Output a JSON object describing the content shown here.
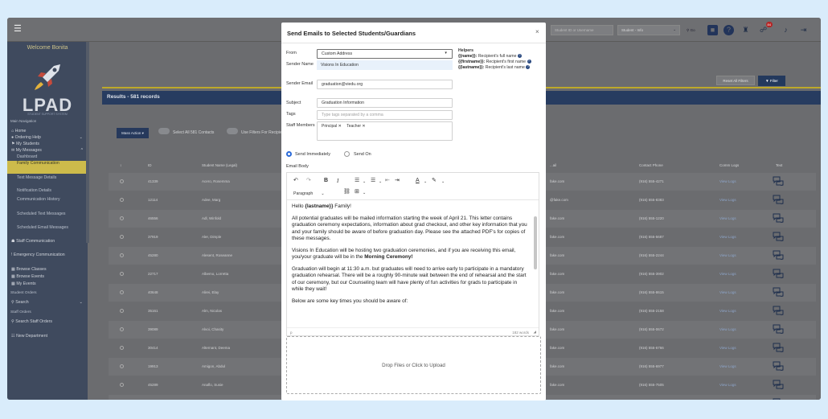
{
  "header": {
    "search_placeholder": "Student ID or Username",
    "search_type": "Student - Info",
    "go_label": "Go",
    "notification_count": "84"
  },
  "sidebar": {
    "welcome": "Welcome Bonita",
    "logo_text": "LPAD",
    "logo_subtext": "STUDENT SUPPORT SYSTEM",
    "main_nav": "Main Navigation",
    "items": [
      {
        "label": "Home",
        "kind": "top"
      },
      {
        "label": "Ordering Help",
        "kind": "top"
      },
      {
        "label": "My Students",
        "kind": "top"
      },
      {
        "label": "My Messages",
        "kind": "top"
      },
      {
        "label": "Dashboard",
        "kind": "sub"
      },
      {
        "label": "Family Communication",
        "kind": "active"
      },
      {
        "label": "Text Message Details",
        "kind": "sub"
      },
      {
        "label": "Notification Details",
        "kind": "sub"
      },
      {
        "label": "Communication History",
        "kind": "sub"
      },
      {
        "label": "Scheduled Text Messages",
        "kind": "sub"
      },
      {
        "label": "Scheduled Email Messages",
        "kind": "sub"
      },
      {
        "label": "Staff Communication",
        "kind": "top"
      },
      {
        "label": "Emergency Communication",
        "kind": "top"
      },
      {
        "label": "Browse Classes",
        "kind": "top"
      },
      {
        "label": "Browse Events",
        "kind": "top"
      },
      {
        "label": "My Events",
        "kind": "top"
      },
      {
        "label": "Student Orders",
        "kind": "head"
      },
      {
        "label": "Search",
        "kind": "top"
      },
      {
        "label": "Staff Orders",
        "kind": "head"
      },
      {
        "label": "Search Staff Orders",
        "kind": "top"
      },
      {
        "label": "New Department",
        "kind": "top"
      }
    ]
  },
  "content": {
    "reset_filters": "Reset All Filters",
    "filter": "Filter",
    "results_title": "Results - 581 records",
    "mass_action": "Mass Action",
    "select_all": "Select All 581 Contacts",
    "use_filters": "Use Filters For Recipients",
    "columns": {
      "id": "ID",
      "name": "Student Name (Legal)",
      "email": "...ail",
      "phone": "Contact Phone",
      "comm": "Comm Logs",
      "text": "Text"
    },
    "rows": [
      {
        "id": "41339",
        "name": "Acero, Rosemma",
        "email": "fake.com",
        "phone": "(916) 555-4271",
        "logs": "View Logs"
      },
      {
        "id": "12114",
        "name": "Adee, Marg",
        "email": "@fake.com",
        "phone": "(916) 555-8383",
        "logs": "View Logs"
      },
      {
        "id": "46556",
        "name": "Adl, Winfold",
        "email": "fake.com",
        "phone": "(916) 555-1220",
        "logs": "View Logs"
      },
      {
        "id": "37919",
        "name": "Aler, Dimple",
        "email": "fake.com",
        "phone": "(916) 555-5687",
        "logs": "View Logs"
      },
      {
        "id": "45280",
        "name": "Alesent, Roseanne",
        "email": "fake.com",
        "phone": "(916) 555-2244",
        "logs": "View Logs"
      },
      {
        "id": "22717",
        "name": "Albemo, Lorretta",
        "email": "fake.com",
        "phone": "(916) 555-3902",
        "logs": "View Logs"
      },
      {
        "id": "40648",
        "name": "Alirei, Elay",
        "email": "fake.com",
        "phone": "(916) 555-8615",
        "logs": "View Logs"
      },
      {
        "id": "35161",
        "name": "Alm, Nicolas",
        "email": "fake.com",
        "phone": "(916) 555-2158",
        "logs": "View Logs"
      },
      {
        "id": "39089",
        "name": "Alvoi, Chasity",
        "email": "fake.com",
        "phone": "(916) 555-0672",
        "logs": "View Logs"
      },
      {
        "id": "30414",
        "name": "Alternant, Deema",
        "email": "fake.com",
        "phone": "(916) 555-6766",
        "logs": "View Logs"
      },
      {
        "id": "19913",
        "name": "Amigon, Abdul",
        "email": "fake.com",
        "phone": "(916) 555-6977",
        "logs": "View Logs"
      },
      {
        "id": "45289",
        "name": "Anaflo, Susie",
        "email": "fake.com",
        "phone": "(916) 555-7505",
        "logs": "View Logs"
      },
      {
        "id": "39952",
        "name": "Aplington, Lucinda",
        "email": "fake.com",
        "phone": "(916) 555-6799",
        "logs": "View Logs"
      },
      {
        "id": "42495",
        "name": "Ards, Martha",
        "email": "@fake.com",
        "phone": "(916) 555-9490",
        "logs": "View Logs"
      }
    ]
  },
  "modal": {
    "title": "Send Emails to Selected Students/Guardians",
    "close": "×",
    "from_label": "From",
    "from_value": "Custom Address",
    "sender_name_label": "Sender Name",
    "sender_name_value": "Visions In Education",
    "sender_email_label": "Sender Email",
    "sender_email_value": "graduation@viedu.org",
    "subject_label": "Subject",
    "subject_value": "Graduation Information",
    "tags_label": "Tags",
    "tags_placeholder": "Type tags separated by a comma",
    "staff_label": "Staff Members",
    "staff_chips": [
      "Principal",
      "Teacher"
    ],
    "helpers_title": "Helpers",
    "helpers": [
      {
        "token": "{{name}}:",
        "desc": "Recipient's full name"
      },
      {
        "token": "{{firstname}}:",
        "desc": "Recipient's first name"
      },
      {
        "token": "{{lastname}}:",
        "desc": "Recipient's last name"
      }
    ],
    "send_immediately": "Send Immediately",
    "send_on": "Send On",
    "email_body_label": "Email Body",
    "paragraph": "Paragraph",
    "body": {
      "greet_pre": "Hello ",
      "greet_token": "{lastname}}",
      "greet_post": " Family!",
      "p1": "All potential graduates will be mailed information starting the week of April 21. This letter contains graduation ceremony expectations, information about grad checkout, and other key information that you and your family should be aware of before graduation day. Please see the attached PDF's for copies of these messages.",
      "p2_pre": "Visions In Education will be hosting two graduation ceremonies, and if you are receiving this email, you/your graduate will be in the ",
      "p2_bold": "Morning Ceremony!",
      "p3": "Graduation will begin at 11:30 a.m. but graduates will need to arrive early to participate in a mandatory graduation rehearsal. There will be a roughly 90-minute wait between the end of rehearsal and the start of our ceremony, but our Counseling team will have plenty of fun activities for grads to participate in while they wait!",
      "p4": "Below are some key times you should be aware of:"
    },
    "status_path": "p",
    "word_count": "182 words",
    "dropzone": "Drop Files or Click to Upload"
  }
}
